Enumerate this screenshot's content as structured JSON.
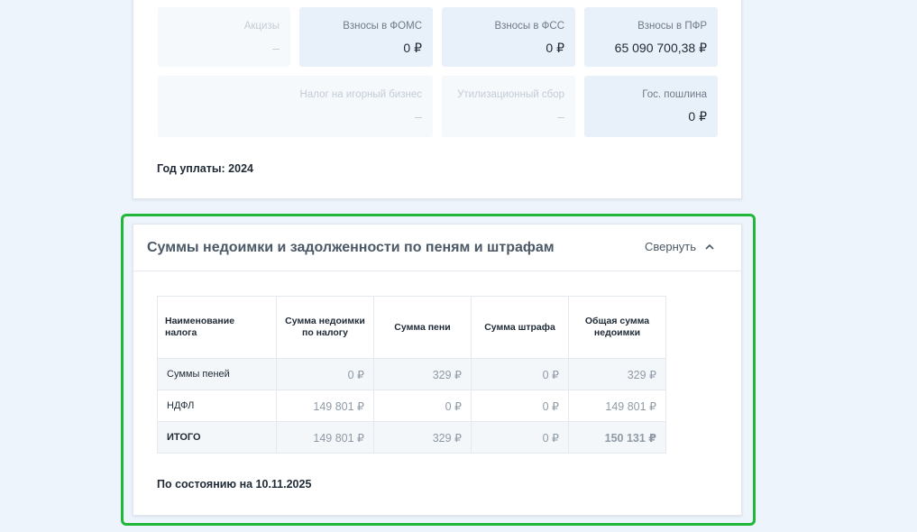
{
  "tax_tiles": [
    {
      "label": "Акцизы",
      "value": "–",
      "active": false
    },
    {
      "label": "Взносы в ФОМС",
      "value": "0 ₽",
      "active": true
    },
    {
      "label": "Взносы в ФСС",
      "value": "0 ₽",
      "active": true
    },
    {
      "label": "Взносы в ПФР",
      "value": "65 090 700,38 ₽",
      "active": true
    },
    {
      "label": "Налог на игорный бизнес",
      "value": "–",
      "active": false
    },
    {
      "label": "Утилизационный сбор",
      "value": "–",
      "active": false
    },
    {
      "label": "Гос. пошлина",
      "value": "0 ₽",
      "active": true
    }
  ],
  "payment_year": "Год уплаты: 2024",
  "debt_section": {
    "title": "Суммы недоимки и задолженности по пеням и штрафам",
    "collapse_label": "Свернуть",
    "collapse_icon": "chevron-up-icon",
    "columns": [
      "Наименование налога",
      "Сумма недоимки по налогу",
      "Сумма пени",
      "Сумма штрафа",
      "Общая сумма недоимки"
    ],
    "rows": [
      {
        "name": "Суммы пеней",
        "arrears": "0 ₽",
        "penalty": "329 ₽",
        "fine": "0 ₽",
        "total": "329 ₽"
      },
      {
        "name": "НДФЛ",
        "arrears": "149 801 ₽",
        "penalty": "0 ₽",
        "fine": "0 ₽",
        "total": "149 801 ₽"
      },
      {
        "name": "ИТОГО",
        "arrears": "149 801 ₽",
        "penalty": "329 ₽",
        "fine": "0 ₽",
        "total": "150 131 ₽"
      }
    ],
    "as_of": "По состоянию на 10.11.2025"
  },
  "colors": {
    "highlight": "#21b83a",
    "tile_active": "#e8f0f9",
    "page_bg": "#eef4fb"
  }
}
